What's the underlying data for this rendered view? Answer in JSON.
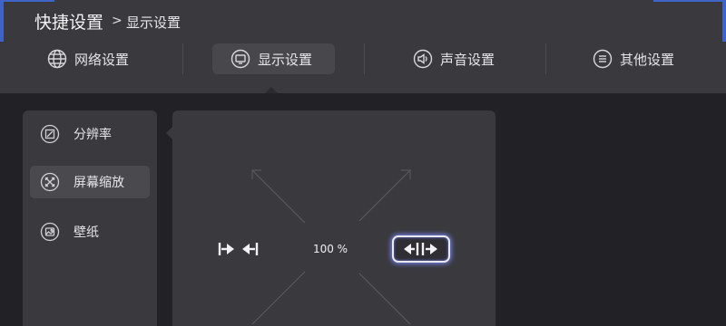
{
  "header": {
    "title": "快捷设置",
    "crumb_separator": ">",
    "crumb": "显示设置"
  },
  "tabs": [
    {
      "label": "网络设置",
      "icon": "globe-icon"
    },
    {
      "label": "显示设置",
      "icon": "monitor-icon",
      "active": true
    },
    {
      "label": "声音设置",
      "icon": "speaker-icon"
    },
    {
      "label": "其他设置",
      "icon": "menu-icon"
    }
  ],
  "sidebar": {
    "items": [
      {
        "label": "分辨率",
        "icon": "resolution-icon"
      },
      {
        "label": "屏幕缩放",
        "icon": "scale-icon",
        "active": true
      },
      {
        "label": "壁纸",
        "icon": "wallpaper-icon"
      }
    ]
  },
  "zoom": {
    "value": "100 %"
  },
  "colors": {
    "accent": "#3f63c9",
    "focus_glow": "#7f8cff"
  }
}
